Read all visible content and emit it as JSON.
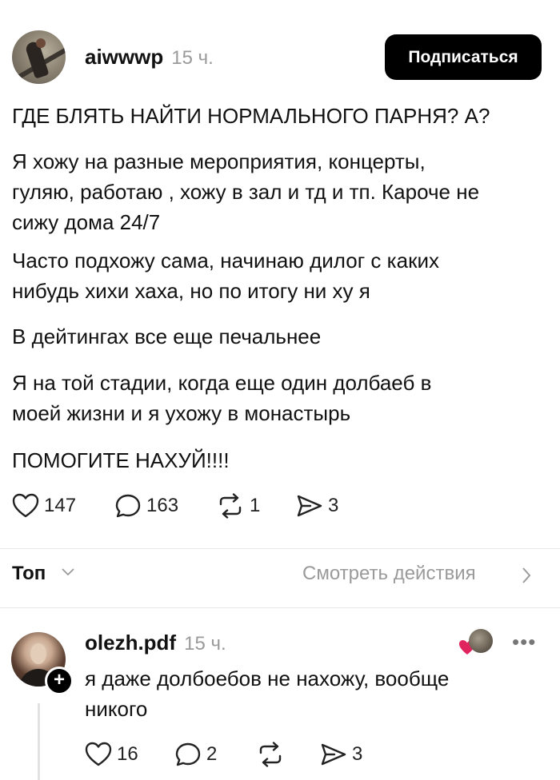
{
  "post": {
    "username": "aiwwwp",
    "time": "15 ч.",
    "follow_label": "Подписаться",
    "lines": [
      "ГДЕ БЛЯТЬ НАЙТИ НОРМАЛЬНОГО ПАРНЯ? А?",
      "Я хожу на разные мероприятия, концерты,",
      "гуляю, работаю , хожу в зал и тд и тп.  Кароче не",
      "сижу дома 24/7",
      "Часто подхожу сама, начинаю дилог с каких",
      "нибудь хихи хаха, но по итогу ни ху я",
      "В дейтингах все еще печальнее",
      "Я на той стадии, когда еще один долбаеб в",
      "моей жизни и я ухожу в монастырь",
      "ПОМОГИТЕ НАХУЙ!!!!"
    ],
    "likes": "147",
    "comments": "163",
    "reposts": "1",
    "shares": "3"
  },
  "sort": {
    "label": "Топ",
    "view_activity": "Смотреть действия"
  },
  "comment": {
    "username": "olezh.pdf",
    "time": "15 ч.",
    "lines": [
      "я даже долбоебов не нахожу, вообще",
      "никого"
    ],
    "likes": "16",
    "comments": "2",
    "shares": "3"
  },
  "icons": {
    "like": "heart-outline-icon",
    "comment": "speech-bubble-icon",
    "repost": "repost-arrows-icon",
    "share": "paper-plane-icon",
    "liked_by_author": "red-heart-icon",
    "more": "ellipsis-icon"
  },
  "colors": {
    "follow_button_bg": "#000000",
    "muted_text": "#9a9a9a",
    "like_red": "#e0245e"
  }
}
